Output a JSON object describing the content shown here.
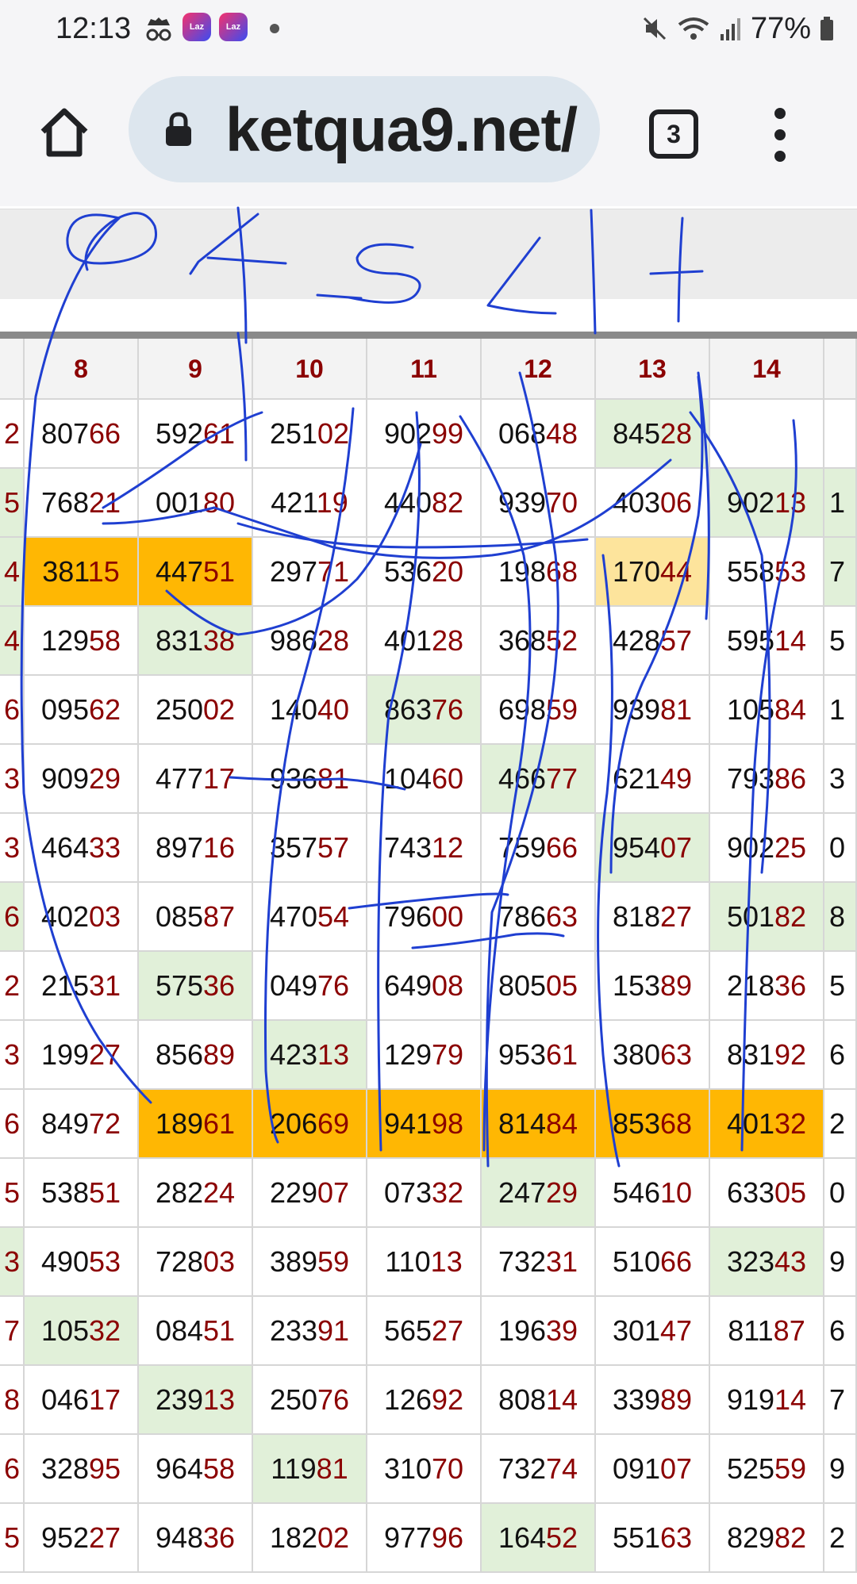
{
  "status_bar": {
    "time": "12:13",
    "laz_badge": "Laz",
    "battery": "77%",
    "icons": [
      "incognito-icon",
      "laz-app-icon",
      "laz-app-icon",
      "notification-dot-icon",
      "mute-icon",
      "wifi-icon",
      "signal-icon",
      "battery-icon"
    ]
  },
  "browser": {
    "url": "ketqua9.net/",
    "tab_count": "3",
    "icons": [
      "home-icon",
      "lock-icon",
      "tabs-icon",
      "more-vert-icon"
    ]
  },
  "table": {
    "headers": [
      "8",
      "9",
      "10",
      "11",
      "12",
      "13",
      "14"
    ],
    "left_edge": [
      "2",
      "5",
      "4",
      "4",
      "6",
      "3",
      "3",
      "6",
      "2",
      "3",
      "6",
      "5",
      "3",
      "7",
      "8",
      "6",
      "5"
    ],
    "right_edge": [
      "",
      "1",
      "7",
      "5",
      "1",
      "3",
      "0",
      "8",
      "5",
      "6",
      "2",
      "0",
      "9",
      "6",
      "7",
      "9",
      "2"
    ],
    "rows": [
      [
        [
          "807",
          "66",
          ""
        ],
        [
          "592",
          "61",
          ""
        ],
        [
          "251",
          "02",
          ""
        ],
        [
          "902",
          "99",
          ""
        ],
        [
          "068",
          "48",
          ""
        ],
        [
          "845",
          "28",
          "g"
        ],
        [
          "",
          "",
          ""
        ]
      ],
      [
        [
          "768",
          "21",
          ""
        ],
        [
          "001",
          "80",
          ""
        ],
        [
          "421",
          "19",
          ""
        ],
        [
          "440",
          "82",
          ""
        ],
        [
          "939",
          "70",
          ""
        ],
        [
          "403",
          "06",
          ""
        ],
        [
          "902",
          "13",
          "g"
        ]
      ],
      [
        [
          "381",
          "15",
          "o"
        ],
        [
          "447",
          "51",
          "o"
        ],
        [
          "297",
          "71",
          ""
        ],
        [
          "536",
          "20",
          ""
        ],
        [
          "198",
          "68",
          ""
        ],
        [
          "170",
          "44",
          "y"
        ],
        [
          "558",
          "53",
          ""
        ]
      ],
      [
        [
          "129",
          "58",
          ""
        ],
        [
          "831",
          "38",
          "g"
        ],
        [
          "986",
          "28",
          ""
        ],
        [
          "401",
          "28",
          ""
        ],
        [
          "368",
          "52",
          ""
        ],
        [
          "428",
          "57",
          ""
        ],
        [
          "595",
          "14",
          ""
        ]
      ],
      [
        [
          "095",
          "62",
          ""
        ],
        [
          "250",
          "02",
          ""
        ],
        [
          "140",
          "40",
          ""
        ],
        [
          "863",
          "76",
          "g"
        ],
        [
          "698",
          "59",
          ""
        ],
        [
          "939",
          "81",
          ""
        ],
        [
          "105",
          "84",
          ""
        ]
      ],
      [
        [
          "909",
          "29",
          ""
        ],
        [
          "477",
          "17",
          ""
        ],
        [
          "936",
          "81",
          ""
        ],
        [
          "104",
          "60",
          ""
        ],
        [
          "466",
          "77",
          "g"
        ],
        [
          "621",
          "49",
          ""
        ],
        [
          "793",
          "86",
          ""
        ]
      ],
      [
        [
          "464",
          "33",
          ""
        ],
        [
          "897",
          "16",
          ""
        ],
        [
          "357",
          "57",
          ""
        ],
        [
          "743",
          "12",
          ""
        ],
        [
          "759",
          "66",
          ""
        ],
        [
          "954",
          "07",
          "g"
        ],
        [
          "902",
          "25",
          ""
        ]
      ],
      [
        [
          "402",
          "03",
          ""
        ],
        [
          "085",
          "87",
          ""
        ],
        [
          "470",
          "54",
          ""
        ],
        [
          "796",
          "00",
          ""
        ],
        [
          "786",
          "63",
          ""
        ],
        [
          "818",
          "27",
          ""
        ],
        [
          "501",
          "82",
          "g"
        ]
      ],
      [
        [
          "215",
          "31",
          ""
        ],
        [
          "575",
          "36",
          "g"
        ],
        [
          "049",
          "76",
          ""
        ],
        [
          "649",
          "08",
          ""
        ],
        [
          "805",
          "05",
          ""
        ],
        [
          "153",
          "89",
          ""
        ],
        [
          "218",
          "36",
          ""
        ]
      ],
      [
        [
          "199",
          "27",
          ""
        ],
        [
          "856",
          "89",
          ""
        ],
        [
          "423",
          "13",
          "g"
        ],
        [
          "129",
          "79",
          ""
        ],
        [
          "953",
          "61",
          ""
        ],
        [
          "380",
          "63",
          ""
        ],
        [
          "831",
          "92",
          ""
        ]
      ],
      [
        [
          "849",
          "72",
          ""
        ],
        [
          "189",
          "61",
          "o"
        ],
        [
          "206",
          "69",
          "o"
        ],
        [
          "941",
          "98",
          "o"
        ],
        [
          "814",
          "84",
          "o"
        ],
        [
          "853",
          "68",
          "o"
        ],
        [
          "401",
          "32",
          "o"
        ]
      ],
      [
        [
          "538",
          "51",
          ""
        ],
        [
          "282",
          "24",
          ""
        ],
        [
          "229",
          "07",
          ""
        ],
        [
          "073",
          "32",
          ""
        ],
        [
          "247",
          "29",
          "g"
        ],
        [
          "546",
          "10",
          ""
        ],
        [
          "633",
          "05",
          ""
        ]
      ],
      [
        [
          "490",
          "53",
          ""
        ],
        [
          "728",
          "03",
          ""
        ],
        [
          "389",
          "59",
          ""
        ],
        [
          "110",
          "13",
          ""
        ],
        [
          "732",
          "31",
          ""
        ],
        [
          "510",
          "66",
          ""
        ],
        [
          "323",
          "43",
          "g"
        ]
      ],
      [
        [
          "105",
          "32",
          "g"
        ],
        [
          "084",
          "51",
          ""
        ],
        [
          "233",
          "91",
          ""
        ],
        [
          "565",
          "27",
          ""
        ],
        [
          "196",
          "39",
          ""
        ],
        [
          "301",
          "47",
          ""
        ],
        [
          "811",
          "87",
          ""
        ]
      ],
      [
        [
          "046",
          "17",
          ""
        ],
        [
          "239",
          "13",
          "g"
        ],
        [
          "250",
          "76",
          ""
        ],
        [
          "126",
          "92",
          ""
        ],
        [
          "808",
          "14",
          ""
        ],
        [
          "339",
          "89",
          ""
        ],
        [
          "919",
          "14",
          ""
        ]
      ],
      [
        [
          "328",
          "95",
          ""
        ],
        [
          "964",
          "58",
          ""
        ],
        [
          "119",
          "81",
          "g"
        ],
        [
          "310",
          "70",
          ""
        ],
        [
          "732",
          "74",
          ""
        ],
        [
          "091",
          "07",
          ""
        ],
        [
          "525",
          "59",
          ""
        ]
      ],
      [
        [
          "952",
          "27",
          ""
        ],
        [
          "948",
          "36",
          ""
        ],
        [
          "182",
          "02",
          ""
        ],
        [
          "977",
          "96",
          ""
        ],
        [
          "164",
          "52",
          "g"
        ],
        [
          "551",
          "63",
          ""
        ],
        [
          "829",
          "82",
          ""
        ]
      ]
    ]
  },
  "colors": {
    "highlight_orange": "#ffb703",
    "highlight_green": "#e1f0d9",
    "highlight_yellow": "#fde49c",
    "digit_red": "#8b0000",
    "ink_blue": "#1f3fd1"
  }
}
